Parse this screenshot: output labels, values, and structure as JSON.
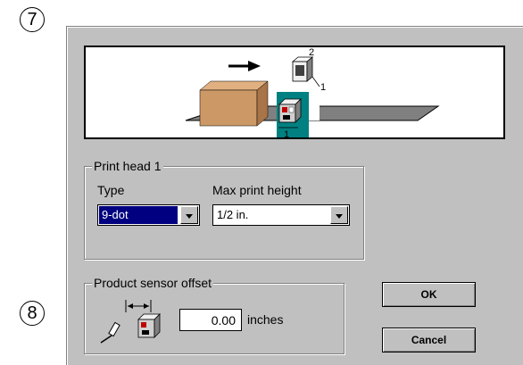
{
  "callouts": [
    "7",
    "8"
  ],
  "preview": {
    "head_labels": [
      "2",
      "1",
      "1"
    ]
  },
  "print_head_group": {
    "title": "Print head 1",
    "type_label": "Type",
    "type_value": "9-dot",
    "max_height_label": "Max print height",
    "max_height_value": "1/2 in."
  },
  "sensor_group": {
    "title": "Product sensor offset",
    "offset_value": "0.00",
    "unit": "inches"
  },
  "buttons": {
    "ok": "OK",
    "cancel": "Cancel"
  },
  "colors": {
    "dialog_bg": "#c0c0c0",
    "selection": "#000080",
    "box": "#cc9966",
    "teal": "#008080"
  }
}
